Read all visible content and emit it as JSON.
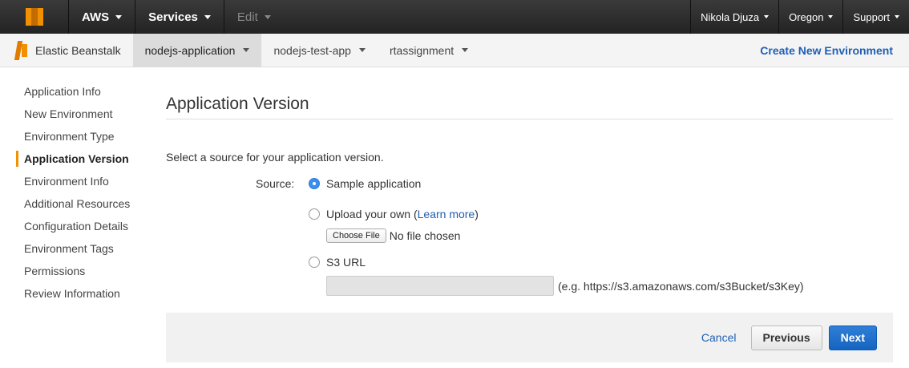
{
  "topbar": {
    "brand": "AWS",
    "services": "Services",
    "edit": "Edit",
    "user": "Nikola Djuza",
    "region": "Oregon",
    "support": "Support"
  },
  "subbar": {
    "service_name": "Elastic Beanstalk",
    "tabs": [
      {
        "label": "nodejs-application",
        "active": true
      },
      {
        "label": "nodejs-test-app",
        "active": false
      },
      {
        "label": "rtassignment",
        "active": false
      }
    ],
    "create_env": "Create New Environment"
  },
  "sidebar": {
    "items": [
      {
        "label": "Application Info"
      },
      {
        "label": "New Environment"
      },
      {
        "label": "Environment Type"
      },
      {
        "label": "Application Version",
        "active": true
      },
      {
        "label": "Environment Info"
      },
      {
        "label": "Additional Resources"
      },
      {
        "label": "Configuration Details"
      },
      {
        "label": "Environment Tags"
      },
      {
        "label": "Permissions"
      },
      {
        "label": "Review Information"
      }
    ]
  },
  "main": {
    "title": "Application Version",
    "intro": "Select a source for your application version.",
    "source_label": "Source:",
    "options": {
      "sample": "Sample application",
      "upload": "Upload your own (",
      "upload_link": "Learn more",
      "upload_end": ")",
      "s3": "S3 URL"
    },
    "selected": "sample",
    "file": {
      "button": "Choose File",
      "status": "No file chosen"
    },
    "s3": {
      "value": "",
      "hint": "(e.g. https://s3.amazonaws.com/s3Bucket/s3Key)"
    }
  },
  "footer": {
    "cancel": "Cancel",
    "previous": "Previous",
    "next": "Next"
  },
  "colors": {
    "accent": "#f29100",
    "link": "#1f5fb4",
    "primary_button": "#1565c0"
  }
}
